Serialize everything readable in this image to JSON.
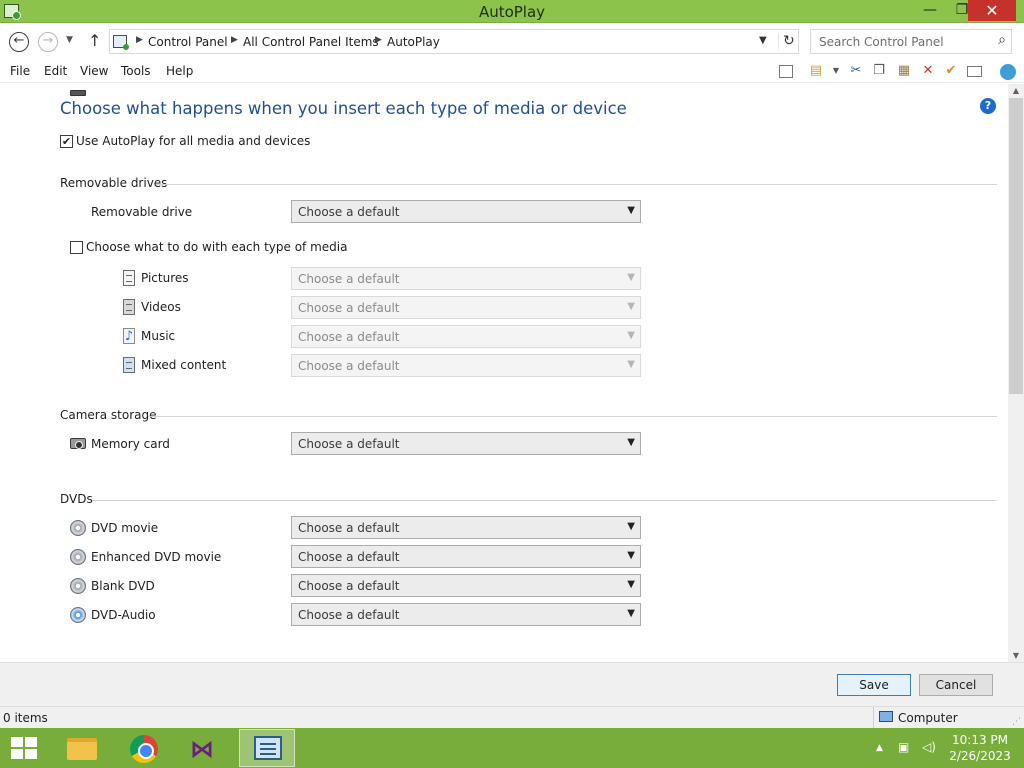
{
  "window": {
    "title": "AutoPlay",
    "minimize_glyph": "—",
    "maximize_glyph": "❐",
    "close_glyph": "✕"
  },
  "address": {
    "breadcrumbs": [
      "Control Panel",
      "All Control Panel Items",
      "AutoPlay"
    ],
    "search_placeholder": "Search Control Panel"
  },
  "menu": {
    "items": [
      "File",
      "Edit",
      "View",
      "Tools",
      "Help"
    ],
    "toolbar_icons": [
      "layout-icon",
      "properties-icon",
      "cut-icon",
      "copy-icon",
      "paste-icon",
      "delete-icon",
      "checkmark-icon",
      "rename-icon",
      "globe-icon"
    ]
  },
  "page": {
    "title": "Choose what happens when you insert each type of media or device",
    "use_autoplay_label": "Use AutoPlay for all media and devices",
    "use_autoplay_checked": true,
    "sections": {
      "removable": {
        "heading": "Removable drives",
        "drive_label": "Removable drive",
        "drive_value": "Choose a default",
        "each_media_label": "Choose what to do with each type of media",
        "each_media_checked": false,
        "media": [
          {
            "label": "Pictures",
            "value": "Choose a default"
          },
          {
            "label": "Videos",
            "value": "Choose a default"
          },
          {
            "label": "Music",
            "value": "Choose a default"
          },
          {
            "label": "Mixed content",
            "value": "Choose a default"
          }
        ]
      },
      "camera": {
        "heading": "Camera storage",
        "items": [
          {
            "label": "Memory card",
            "value": "Choose a default"
          }
        ]
      },
      "dvds": {
        "heading": "DVDs",
        "items": [
          {
            "label": "DVD movie",
            "value": "Choose a default"
          },
          {
            "label": "Enhanced DVD movie",
            "value": "Choose a default"
          },
          {
            "label": "Blank DVD",
            "value": "Choose a default"
          },
          {
            "label": "DVD-Audio",
            "value": "Choose a default"
          }
        ]
      }
    }
  },
  "buttons": {
    "save": "Save",
    "cancel": "Cancel"
  },
  "status": {
    "items": "0 items",
    "location": "Computer"
  },
  "taskbar": {
    "time": "10:13 PM",
    "date": "2/26/2023"
  },
  "colors": {
    "title_bar": "#8cc34a",
    "taskbar": "#78ad3c",
    "heading_blue": "#1f4e9c",
    "close_red": "#c7312b"
  }
}
